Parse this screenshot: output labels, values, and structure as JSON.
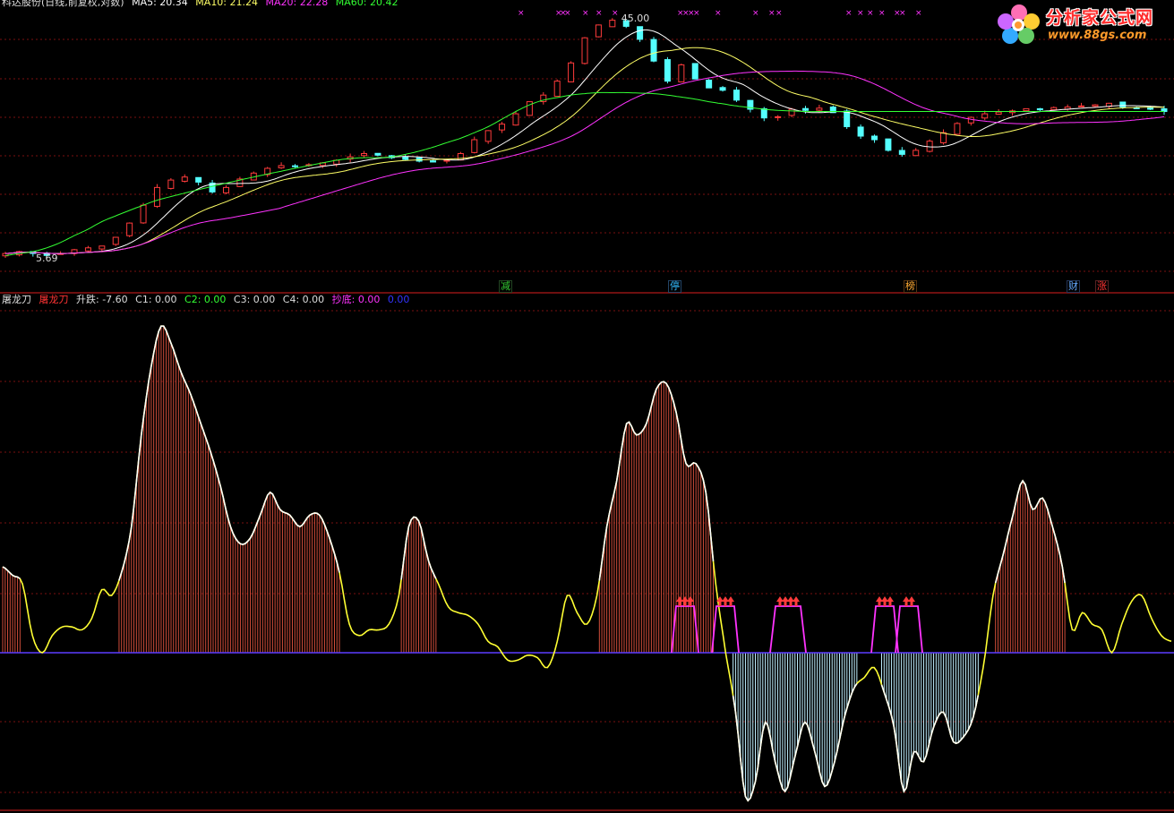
{
  "price_panel": {
    "stock_label": "科达股份(日线,前复权,对数)",
    "ma": [
      {
        "label": "MA5: 20.34",
        "color": "#ffffff"
      },
      {
        "label": "MA10: 21.24",
        "color": "#ffff66"
      },
      {
        "label": "MA20: 22.28",
        "color": "#ff33ff"
      },
      {
        "label": "MA60: 20.42",
        "color": "#33ff33"
      }
    ],
    "high_label": "45.00",
    "low_label": "5.69",
    "events": [
      {
        "label": "减",
        "color": "#33cc33"
      },
      {
        "label": "停",
        "color": "#33bbff"
      },
      {
        "label": "榜",
        "color": "#ffaa33"
      },
      {
        "label": "财",
        "color": "#66aaff"
      },
      {
        "label": "涨",
        "color": "#ff3333"
      }
    ]
  },
  "oscillator_panel": {
    "name": "屠龙刀",
    "name_color": "#dddddd",
    "signal_name": "屠龙刀",
    "signal_color": "#ff3333",
    "values": [
      {
        "label": "升跌: -7.60",
        "color": "#dddddd"
      },
      {
        "label": "C1: 0.00",
        "color": "#dddddd"
      },
      {
        "label": "C2: 0.00",
        "color": "#33ff33"
      },
      {
        "label": "C3: 0.00",
        "color": "#dddddd"
      },
      {
        "label": "C4: 0.00",
        "color": "#dddddd"
      },
      {
        "label": "抄底: 0.00",
        "color": "#ff33ff"
      },
      {
        "label": "0.00",
        "color": "#3333ff"
      }
    ]
  },
  "watermark": {
    "site_name": "分析家公式网",
    "url": "www.88gs.com"
  },
  "chart_data": {
    "type": "line",
    "price_series": {
      "name": "K线",
      "scale": "log",
      "range": [
        5.69,
        45.0
      ],
      "close": [
        6.0,
        6.1,
        6.0,
        5.9,
        6.0,
        6.2,
        6.3,
        6.4,
        6.9,
        7.8,
        9.1,
        10.6,
        11.3,
        11.6,
        11.1,
        10.2,
        10.6,
        11.4,
        12.0,
        12.5,
        12.8,
        12.7,
        12.9,
        13.1,
        13.4,
        13.8,
        14.2,
        14.0,
        13.7,
        13.5,
        13.3,
        13.2,
        13.4,
        14.2,
        16.0,
        17.3,
        18.3,
        20.0,
        22.2,
        23.5,
        26.5,
        31.0,
        38.5,
        43.0,
        44.8,
        42.5,
        38.0,
        31.5,
        26.5,
        30.5,
        27.0,
        25.0,
        24.5,
        22.5,
        20.8,
        19.3,
        19.5,
        20.8,
        20.6,
        21.0,
        20.2,
        17.9,
        16.5,
        16.0,
        14.6,
        14.1,
        14.6,
        15.8,
        17.0,
        18.4,
        19.4,
        20.0,
        20.3,
        20.5,
        20.9,
        20.7,
        21.1,
        21.2,
        21.4,
        21.6,
        21.9,
        21.2,
        21.0,
        20.8,
        20.4
      ],
      "ma60": [
        5.9,
        6.0,
        6.1,
        6.3,
        6.6,
        7.0,
        7.4,
        7.9,
        8.3,
        8.7,
        9.1,
        9.5,
        9.8,
        10.1,
        10.4,
        10.7,
        11.0,
        11.3,
        11.6,
        11.9,
        12.2,
        12.5,
        12.8,
        13.1,
        13.4,
        13.6,
        13.7,
        13.7,
        13.8,
        14.1,
        14.5,
        15.0,
        15.6,
        16.2,
        17.0,
        17.9,
        19.1,
        20.4,
        21.6,
        22.5,
        23.0,
        23.5,
        23.8,
        24.0,
        24.0,
        24.0,
        23.9,
        23.8,
        23.5,
        23.1,
        22.7,
        22.2,
        21.8,
        21.4,
        21.1,
        20.8,
        20.6,
        20.5,
        20.4,
        20.4,
        20.4,
        20.4,
        20.4,
        20.4,
        20.4,
        20.4,
        20.4,
        20.4,
        20.4,
        20.4,
        20.4,
        20.4,
        20.4,
        20.4,
        20.4,
        20.4,
        20.4,
        20.4,
        20.4,
        20.4,
        20.4,
        20.4,
        20.4,
        20.4,
        20.4
      ]
    },
    "oscillator_series": {
      "name": "屠龙刀",
      "zero_line": 0,
      "range": [
        -30,
        60
      ],
      "values": [
        15.0,
        13.5,
        12.0,
        3.0,
        0.0,
        3.0,
        4.5,
        4.5,
        4.0,
        6.0,
        11.0,
        10.0,
        14.0,
        22.0,
        38.0,
        50.0,
        57.0,
        54.0,
        49.0,
        45.0,
        40.0,
        35.0,
        29.0,
        22.0,
        19.0,
        20.0,
        24.0,
        28.0,
        25.0,
        24.0,
        22.0,
        24.0,
        24.0,
        20.0,
        14.0,
        5.0,
        3.0,
        4.0,
        4.0,
        5.0,
        10.0,
        22.0,
        23.0,
        16.0,
        12.0,
        8.0,
        7.0,
        6.5,
        5.0,
        2.0,
        1.0,
        -1.5,
        -1.5,
        -0.5,
        -1.0,
        -3.0,
        2.0,
        10.0,
        7.0,
        5.0,
        10.0,
        22.0,
        30.0,
        40.0,
        38.0,
        40.0,
        46.0,
        47.0,
        42.0,
        33.0,
        33.0,
        28.0,
        12.0,
        0.0,
        -12.0,
        -29.0,
        -26.0,
        -14.0,
        -22.0,
        -28.0,
        -21.0,
        -14.0,
        -20.0,
        -27.0,
        -22.0,
        -13.0,
        -7.0,
        -5.0,
        -3.0,
        -8.0,
        -15.0,
        -28.0,
        -20.0,
        -22.0,
        -15.0,
        -12.0,
        -18.0,
        -17.0,
        -13.0,
        -3.0,
        10.0,
        17.0,
        24.0,
        30.0,
        25.0,
        27.0,
        22.0,
        15.0,
        4.0,
        7.0,
        5.0,
        4.0,
        0.0,
        5.0,
        9.0,
        10.0,
        6.0,
        3.0,
        2.0
      ]
    },
    "buy_signals": 5
  }
}
